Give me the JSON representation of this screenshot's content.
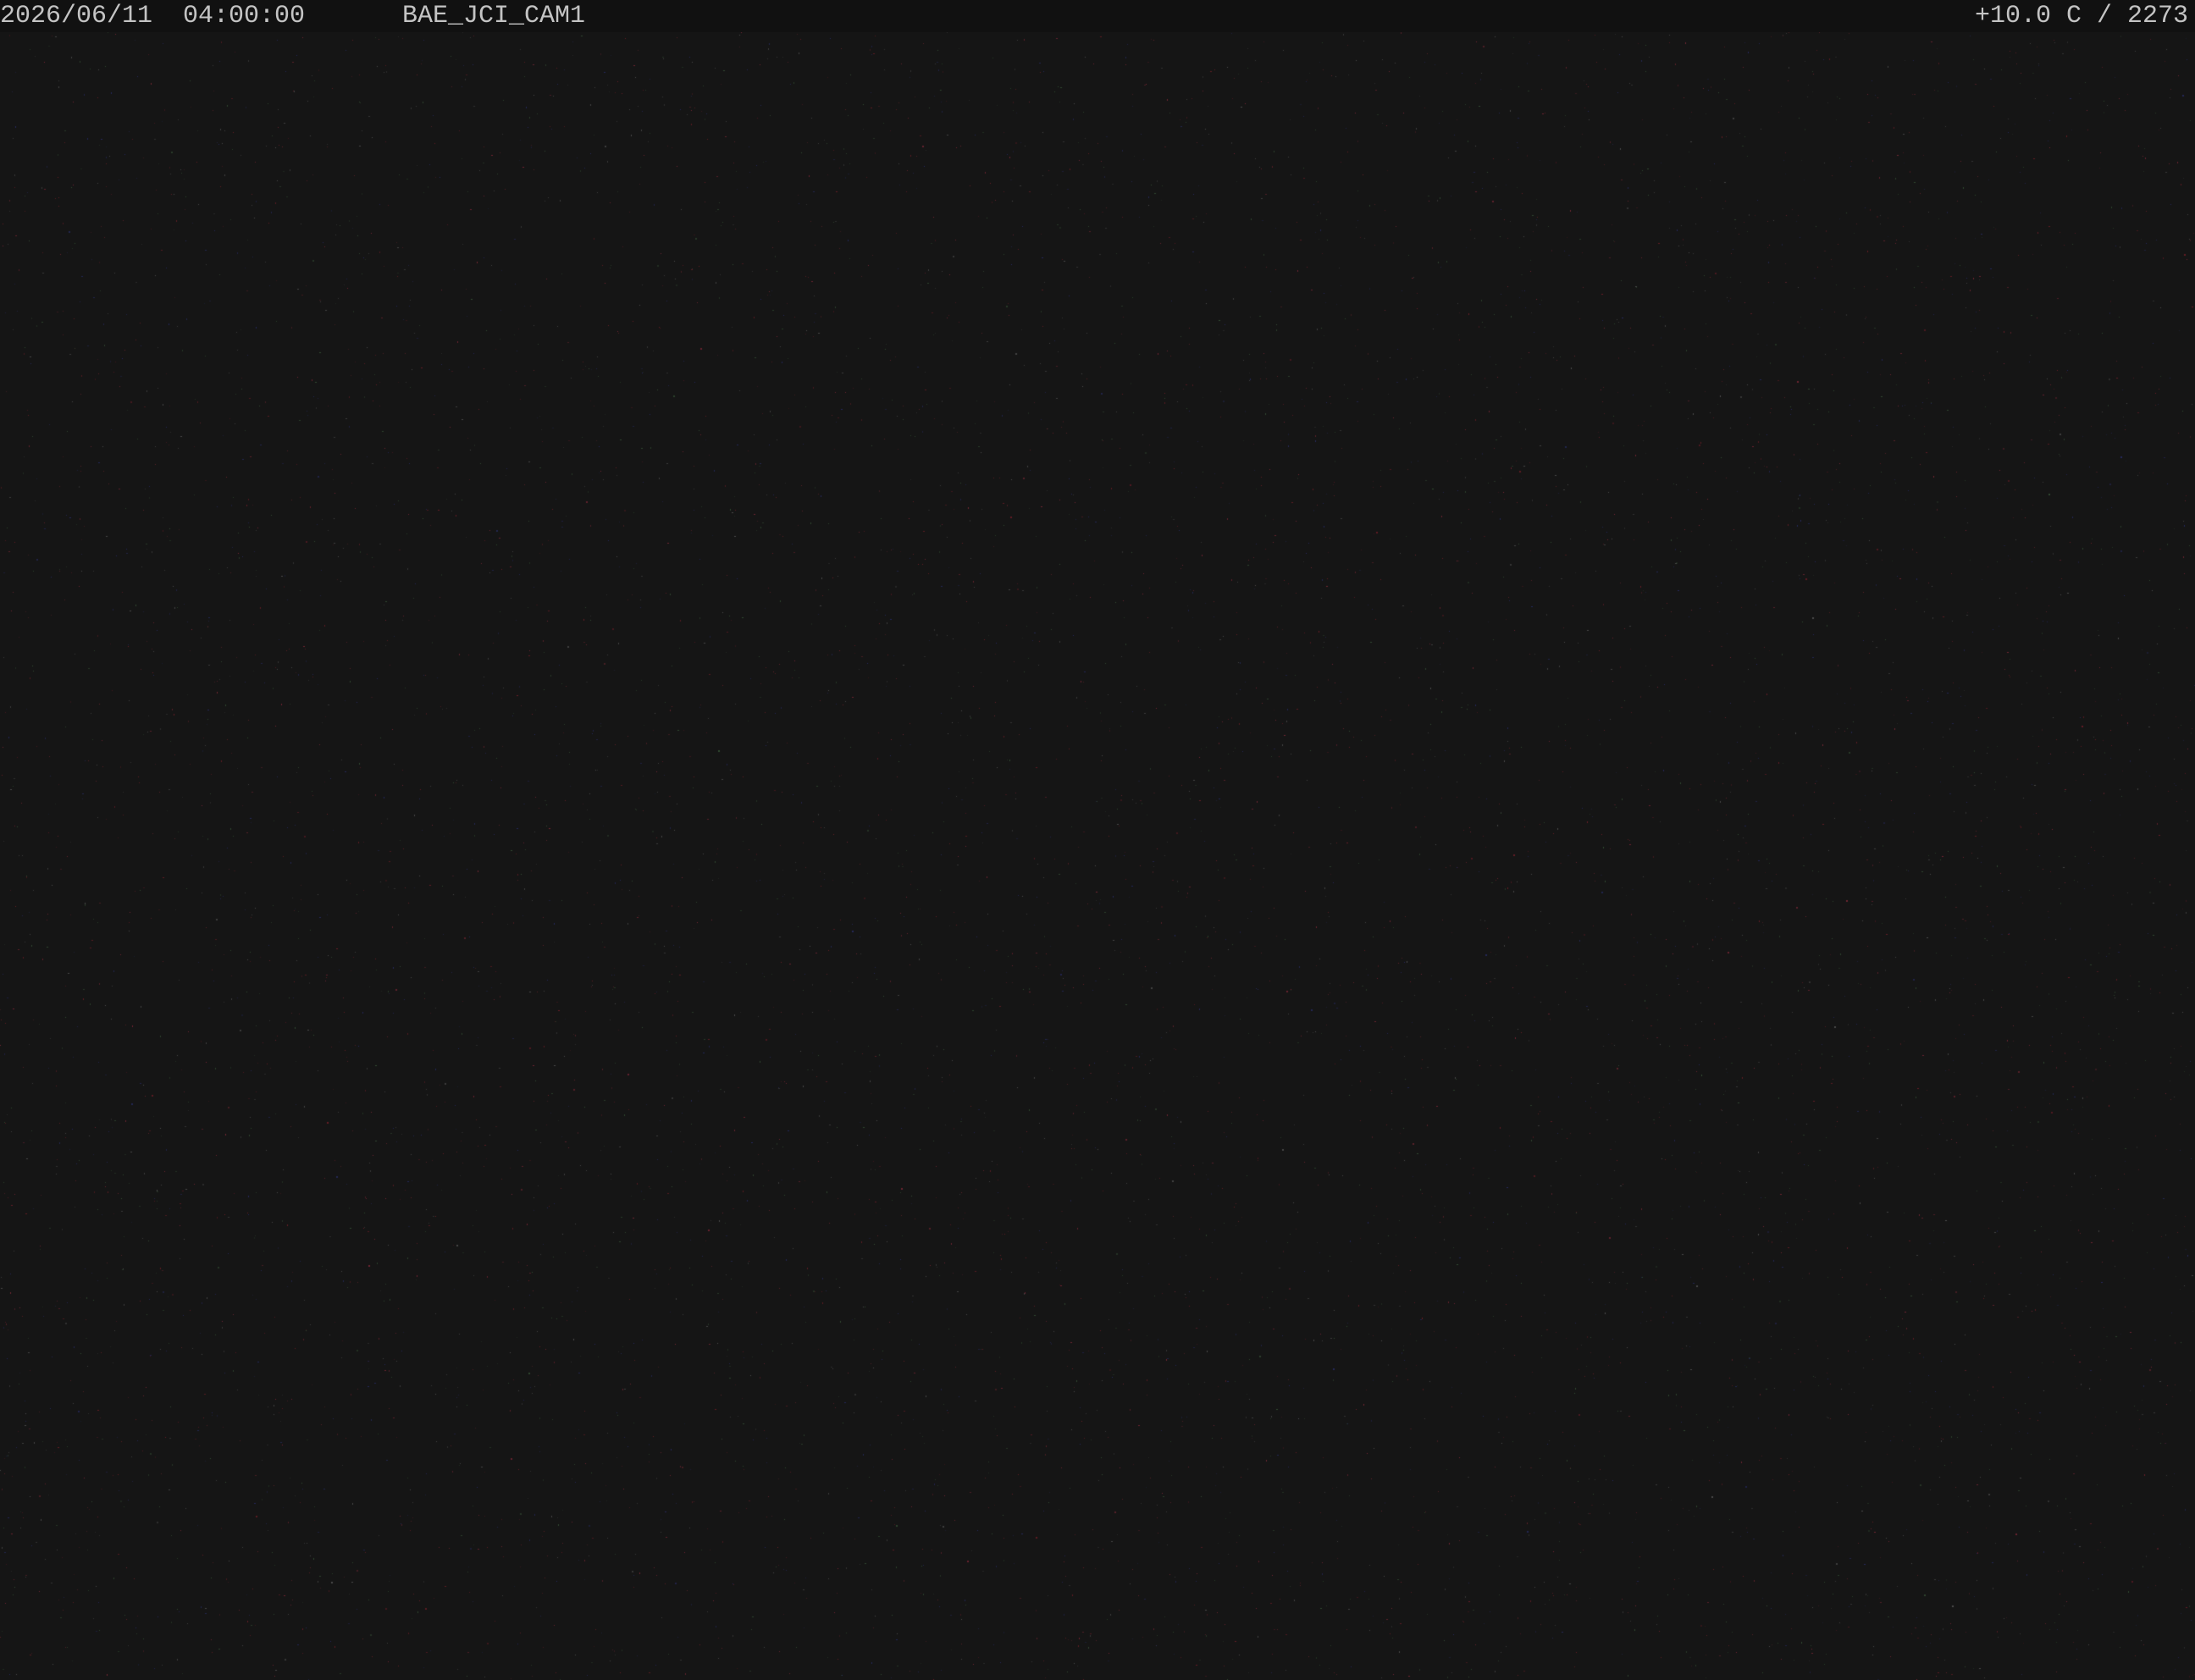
{
  "overlay": {
    "datetime": "2026/06/11  04:00:00",
    "camera_name": "BAE_JCI_CAM1",
    "status": "+10.0 C / 2273"
  },
  "scene": {
    "description_type": "night-sky-camera-frame",
    "background_color": "#151515",
    "noise_colors": [
      "#7a1f2a",
      "#2a2f6e",
      "#3a5a3a",
      "#8a2a3a",
      "#5a5a5a"
    ]
  }
}
